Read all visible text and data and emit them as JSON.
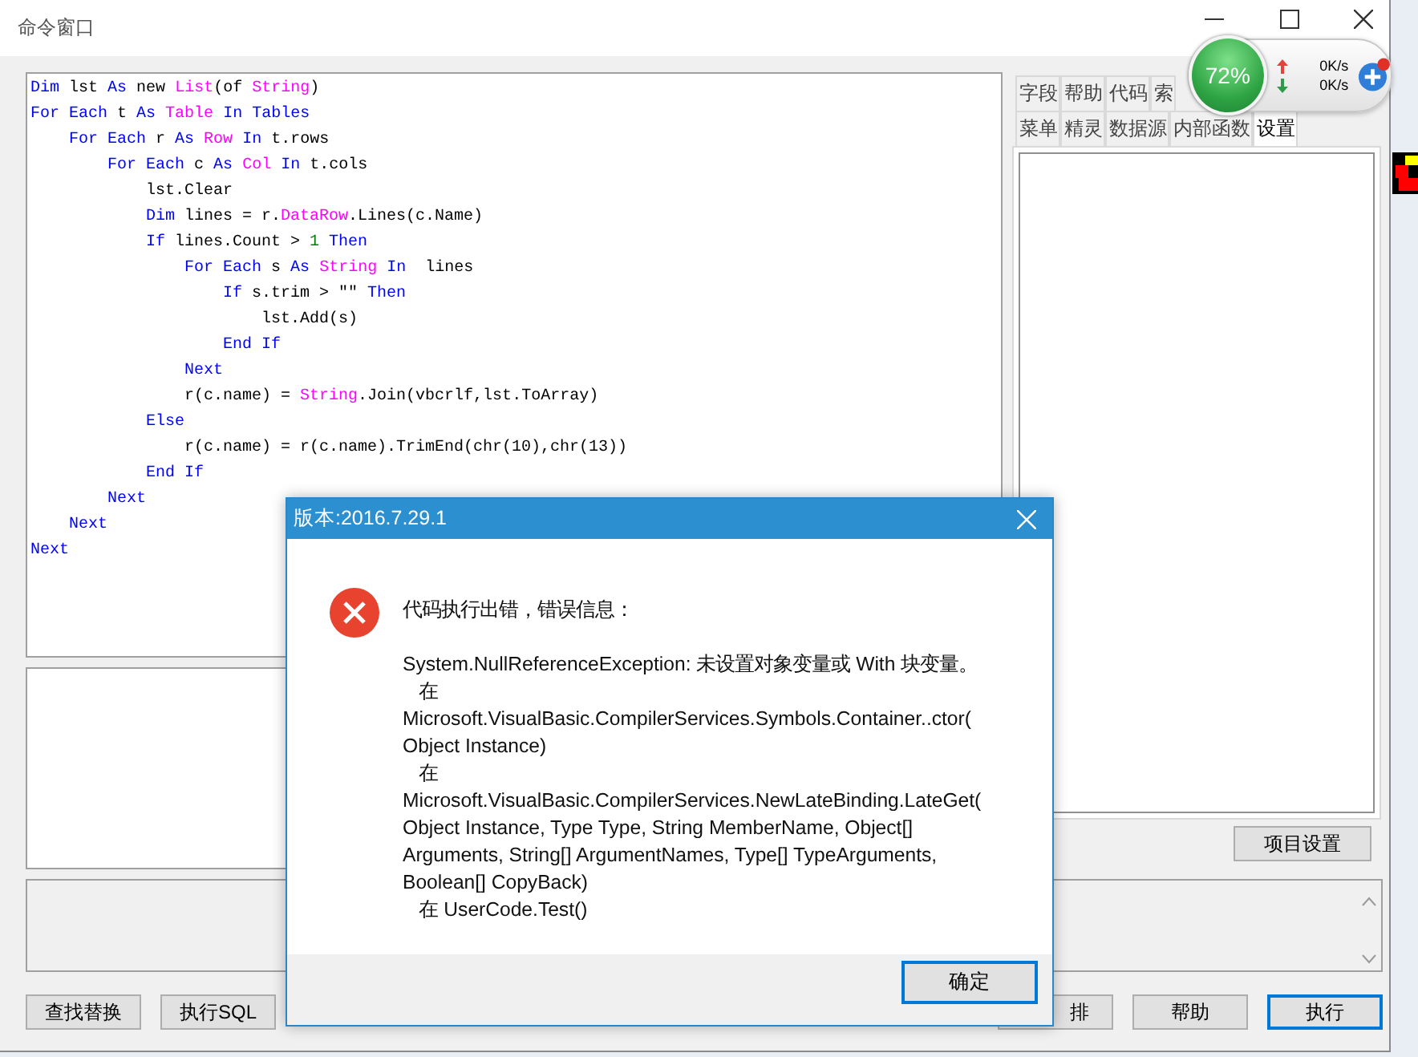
{
  "window": {
    "title": "命令窗口"
  },
  "code_lines": [
    [
      {
        "t": "Dim ",
        "kind": "kw"
      },
      {
        "t": "lst ",
        "kind": "text"
      },
      {
        "t": "As ",
        "kind": "kw"
      },
      {
        "t": "new ",
        "kind": "text"
      },
      {
        "t": "List",
        "kind": "type"
      },
      {
        "t": "(of ",
        "kind": "text"
      },
      {
        "t": "String",
        "kind": "type"
      },
      {
        "t": ")",
        "kind": "text"
      }
    ],
    [
      {
        "t": "For Each ",
        "kind": "kw"
      },
      {
        "t": "t ",
        "kind": "text"
      },
      {
        "t": "As ",
        "kind": "kw"
      },
      {
        "t": "Table ",
        "kind": "type"
      },
      {
        "t": "In Tables",
        "kind": "kw"
      }
    ],
    [
      {
        "t": "    For Each ",
        "kind": "kw"
      },
      {
        "t": "r ",
        "kind": "text"
      },
      {
        "t": "As ",
        "kind": "kw"
      },
      {
        "t": "Row ",
        "kind": "type"
      },
      {
        "t": "In ",
        "kind": "kw"
      },
      {
        "t": "t.rows",
        "kind": "text"
      }
    ],
    [
      {
        "t": "        For Each ",
        "kind": "kw"
      },
      {
        "t": "c ",
        "kind": "text"
      },
      {
        "t": "As ",
        "kind": "kw"
      },
      {
        "t": "Col ",
        "kind": "type"
      },
      {
        "t": "In ",
        "kind": "kw"
      },
      {
        "t": "t.cols",
        "kind": "text"
      }
    ],
    [
      {
        "t": "            lst.Clear",
        "kind": "text"
      }
    ],
    [
      {
        "t": "            Dim ",
        "kind": "kw"
      },
      {
        "t": "lines = r.",
        "kind": "text"
      },
      {
        "t": "DataRow",
        "kind": "type"
      },
      {
        "t": ".Lines(c.Name)",
        "kind": "text"
      }
    ],
    [
      {
        "t": "            If ",
        "kind": "kw"
      },
      {
        "t": "lines.Count > ",
        "kind": "text"
      },
      {
        "t": "1 ",
        "kind": "num"
      },
      {
        "t": "Then",
        "kind": "kw"
      }
    ],
    [
      {
        "t": "                For Each ",
        "kind": "kw"
      },
      {
        "t": "s ",
        "kind": "text"
      },
      {
        "t": "As ",
        "kind": "kw"
      },
      {
        "t": "String ",
        "kind": "type"
      },
      {
        "t": "In ",
        "kind": "kw"
      },
      {
        "t": " lines",
        "kind": "text"
      }
    ],
    [
      {
        "t": "                    If ",
        "kind": "kw"
      },
      {
        "t": "s.trim > \"\" ",
        "kind": "text"
      },
      {
        "t": "Then",
        "kind": "kw"
      }
    ],
    [
      {
        "t": "                        lst.Add(s)",
        "kind": "text"
      }
    ],
    [
      {
        "t": "                    End If",
        "kind": "kw"
      }
    ],
    [
      {
        "t": "                Next",
        "kind": "kw"
      }
    ],
    [
      {
        "t": "                r(c.name) = ",
        "kind": "text"
      },
      {
        "t": "String",
        "kind": "type"
      },
      {
        "t": ".Join(vbcrlf,lst.ToArray)",
        "kind": "text"
      }
    ],
    [
      {
        "t": "            Else",
        "kind": "kw"
      }
    ],
    [
      {
        "t": "                r(c.name) = r(c.name).TrimEnd(chr(10),chr(13))",
        "kind": "text"
      }
    ],
    [
      {
        "t": "            End If",
        "kind": "kw"
      }
    ],
    [
      {
        "t": "        Next",
        "kind": "kw"
      }
    ],
    [
      {
        "t": "    Next",
        "kind": "kw"
      }
    ],
    [
      {
        "t": "Next",
        "kind": "kw"
      }
    ]
  ],
  "tab_rows": [
    [
      {
        "label": "字段",
        "selected": false
      },
      {
        "label": "帮助",
        "selected": false
      },
      {
        "label": "代码",
        "selected": false
      },
      {
        "label": "索",
        "selected": false
      }
    ],
    [
      {
        "label": "菜单",
        "selected": false
      },
      {
        "label": "精灵",
        "selected": false
      },
      {
        "label": "数据源",
        "selected": false
      },
      {
        "label": "内部函数",
        "selected": false
      },
      {
        "label": "设置",
        "selected": true
      }
    ]
  ],
  "settings_button": "项目设置",
  "bottom_buttons": [
    {
      "label": "查找替换",
      "default": false
    },
    {
      "label": "执行SQL",
      "default": false
    }
  ],
  "right_buttons": [
    {
      "label": "排",
      "default": false
    },
    {
      "label": "帮助",
      "default": false
    },
    {
      "label": "执行",
      "default": true
    }
  ],
  "net_widget": {
    "percent": "72%",
    "upload": "0K/s",
    "download": "0K/s"
  },
  "dialog": {
    "title": "版本:2016.7.29.1",
    "heading": "代码执行出错，错误信息：",
    "detail_lines": [
      "System.NullReferenceException: 未设置对象变量或 With 块变量。",
      "   在",
      "Microsoft.VisualBasic.CompilerServices.Symbols.Container..ctor(",
      "Object Instance)",
      "   在",
      "Microsoft.VisualBasic.CompilerServices.NewLateBinding.LateGet(",
      "Object Instance, Type Type, String MemberName, Object[]",
      "Arguments, String[] ArgumentNames, Type[] TypeArguments,",
      "Boolean[] CopyBack)",
      "   在 UserCode.Test()"
    ],
    "ok_button": "确定"
  }
}
